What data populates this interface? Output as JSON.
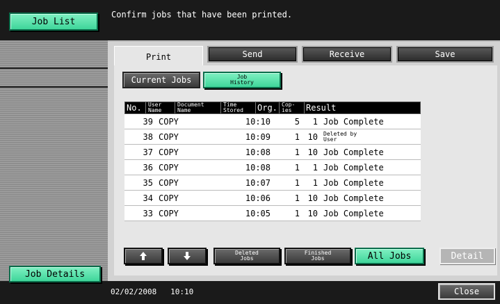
{
  "sidebar": {
    "job_list_label": "Job List",
    "job_details_label": "Job Details"
  },
  "header": {
    "message": "Confirm jobs that have been printed."
  },
  "tabs": [
    {
      "label": "Print",
      "active": true
    },
    {
      "label": "Send",
      "active": false
    },
    {
      "label": "Receive",
      "active": false
    },
    {
      "label": "Save",
      "active": false
    }
  ],
  "subtabs": {
    "current_jobs": "Current Jobs",
    "job_history_line1": "Job",
    "job_history_line2": "History"
  },
  "table": {
    "headers": {
      "no": "No.",
      "user_name_1": "User",
      "user_name_2": "Name",
      "doc_name_1": "Document",
      "doc_name_2": "Name",
      "time_1": "Time",
      "time_2": "Stored",
      "org": "Org.",
      "copies_1": "Cop-",
      "copies_2": "ies",
      "result": "Result"
    },
    "rows": [
      {
        "no": "39",
        "user": "COPY",
        "doc": "",
        "time": "10:10",
        "org": "5",
        "copies": "1",
        "result": "Job Complete"
      },
      {
        "no": "38",
        "user": "COPY",
        "doc": "",
        "time": "10:09",
        "org": "1",
        "copies": "10",
        "result_line1": "Deleted by",
        "result_line2": "User"
      },
      {
        "no": "37",
        "user": "COPY",
        "doc": "",
        "time": "10:08",
        "org": "1",
        "copies": "10",
        "result": "Job Complete"
      },
      {
        "no": "36",
        "user": "COPY",
        "doc": "",
        "time": "10:08",
        "org": "1",
        "copies": "1",
        "result": "Job Complete"
      },
      {
        "no": "35",
        "user": "COPY",
        "doc": "",
        "time": "10:07",
        "org": "1",
        "copies": "1",
        "result": "Job Complete"
      },
      {
        "no": "34",
        "user": "COPY",
        "doc": "",
        "time": "10:06",
        "org": "1",
        "copies": "10",
        "result": "Job Complete"
      },
      {
        "no": "33",
        "user": "COPY",
        "doc": "",
        "time": "10:05",
        "org": "1",
        "copies": "10",
        "result": "Job Complete"
      }
    ]
  },
  "controls": {
    "deleted_1": "Deleted",
    "deleted_2": "Jobs",
    "finished_1": "Finished",
    "finished_2": "Jobs",
    "all_jobs": "All Jobs",
    "detail": "Detail",
    "close": "Close"
  },
  "footer": {
    "date": "02/02/2008",
    "time": "10:10"
  },
  "colors": {
    "green_button": "#3fd69a",
    "panel_gray": "#d2d2d2",
    "header_black": "#000000"
  }
}
